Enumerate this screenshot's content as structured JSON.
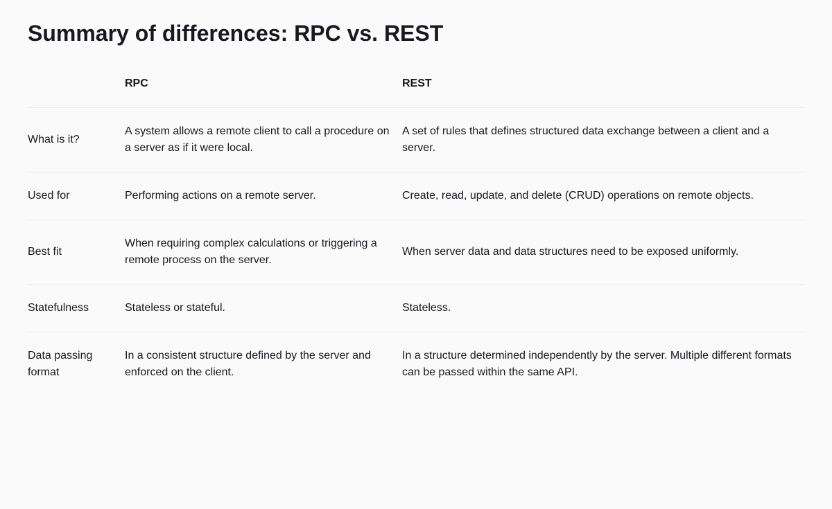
{
  "title": "Summary of differences: RPC vs. REST",
  "columns": {
    "blank": "",
    "rpc": "RPC",
    "rest": "REST"
  },
  "rows": [
    {
      "label": "What is it?",
      "rpc": "A system allows a remote client to call a procedure on a server as if it were local.",
      "rest": "A set of rules that defines structured data exchange between a client and a server."
    },
    {
      "label": "Used for",
      "rpc": "Performing actions on a remote server.",
      "rest": "Create, read, update, and delete (CRUD) operations on remote objects."
    },
    {
      "label": "Best fit",
      "rpc": "When requiring complex calculations or triggering a remote process on the server.",
      "rest": "When server data and data structures need to be exposed uniformly."
    },
    {
      "label": "Statefulness",
      "rpc": "Stateless or stateful.",
      "rest": "Stateless."
    },
    {
      "label": "Data passing format",
      "rpc": "In a consistent structure defined by the server and enforced on the client.",
      "rest": "In a structure determined independently by the server. Multiple different formats can be passed within the same API."
    }
  ]
}
